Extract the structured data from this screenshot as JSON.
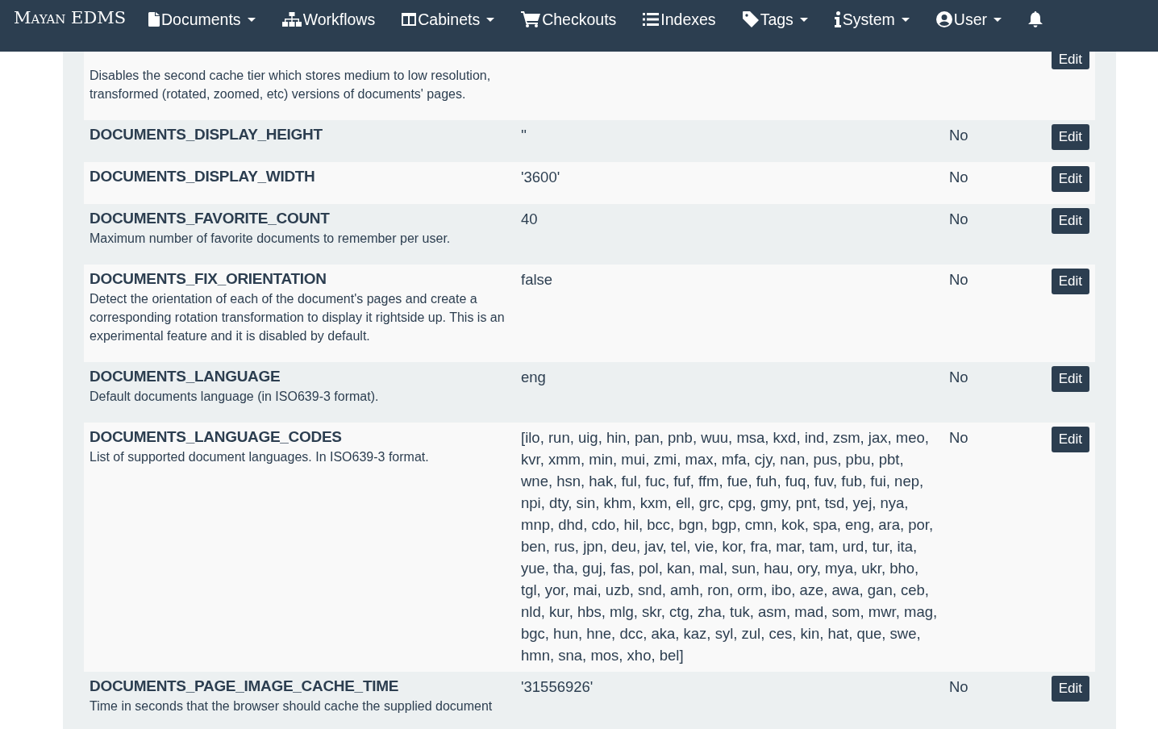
{
  "navbar": {
    "brand": "Mayan EDMS",
    "items": [
      {
        "kind": "document",
        "label": "Documents",
        "dropdown": true
      },
      {
        "kind": "sitemap",
        "label": "Workflows",
        "dropdown": false
      },
      {
        "kind": "cabinet",
        "label": "Cabinets",
        "dropdown": true
      },
      {
        "kind": "cart",
        "label": "Checkouts",
        "dropdown": false
      },
      {
        "kind": "list",
        "label": "Indexes",
        "dropdown": false
      },
      {
        "kind": "tag",
        "label": "Tags",
        "dropdown": true
      },
      {
        "kind": "info",
        "label": "System",
        "dropdown": true
      },
      {
        "kind": "user",
        "label": "User",
        "dropdown": true
      },
      {
        "kind": "bell",
        "dropdown": false
      }
    ]
  },
  "settings": [
    {
      "description": "Disables the second cache tier which stores medium to low resolution, transformed (rotated, zoomed, etc) versions of documents' pages.",
      "action": "Edit"
    },
    {
      "name": "DOCUMENTS_DISPLAY_HEIGHT",
      "value": "''",
      "overridden": "No",
      "action": "Edit"
    },
    {
      "name": "DOCUMENTS_DISPLAY_WIDTH",
      "value": "'3600'",
      "overridden": "No",
      "action": "Edit"
    },
    {
      "name": "DOCUMENTS_FAVORITE_COUNT",
      "description": "Maximum number of favorite documents to remember per user.",
      "value": "40",
      "overridden": "No",
      "action": "Edit"
    },
    {
      "name": "DOCUMENTS_FIX_ORIENTATION",
      "description": "Detect the orientation of each of the document's pages and create a corresponding rotation transformation to display it rightside up. This is an experimental feature and it is disabled by default.",
      "value": "false",
      "overridden": "No",
      "action": "Edit"
    },
    {
      "name": "DOCUMENTS_LANGUAGE",
      "description": "Default documents language (in ISO639-3 format).",
      "value": "eng",
      "overridden": "No",
      "action": "Edit"
    },
    {
      "name": "DOCUMENTS_LANGUAGE_CODES",
      "description": "List of supported document languages. In ISO639-3 format.",
      "value": "[ilo, run, uig, hin, pan, pnb, wuu, msa, kxd, ind, zsm, jax, meo, kvr, xmm, min, mui, zmi, max, mfa, cjy, nan, pus, pbu, pbt, wne, hsn, hak, ful, fuc, fuf, ffm, fue, fuh, fuq, fuv, fub, fui, nep, npi, dty, sin, khm, kxm, ell, grc, cpg, gmy, pnt, tsd, yej, nya, mnp, dhd, cdo, hil, bcc, bgn, bgp, cmn, kok, spa, eng, ara, por, ben, rus, jpn, deu, jav, tel, vie, kor, fra, mar, tam, urd, tur, ita, yue, tha, guj, fas, pol, kan, mal, sun, hau, ory, mya, ukr, bho, tgl, yor, mai, uzb, snd, amh, ron, orm, ibo, aze, awa, gan, ceb, nld, kur, hbs, mlg, skr, ctg, zha, tuk, asm, mad, som, mwr, mag, bgc, hun, hne, dcc, aka, kaz, syl, zul, ces, kin, hat, que, swe, hmn, sna, mos, xho, bel]",
      "overridden": "No",
      "action": "Edit"
    },
    {
      "name": "DOCUMENTS_PAGE_IMAGE_CACHE_TIME",
      "description": "Time in seconds that the browser should cache the supplied document",
      "value": "'31556926'",
      "overridden": "No",
      "action": "Edit"
    }
  ]
}
